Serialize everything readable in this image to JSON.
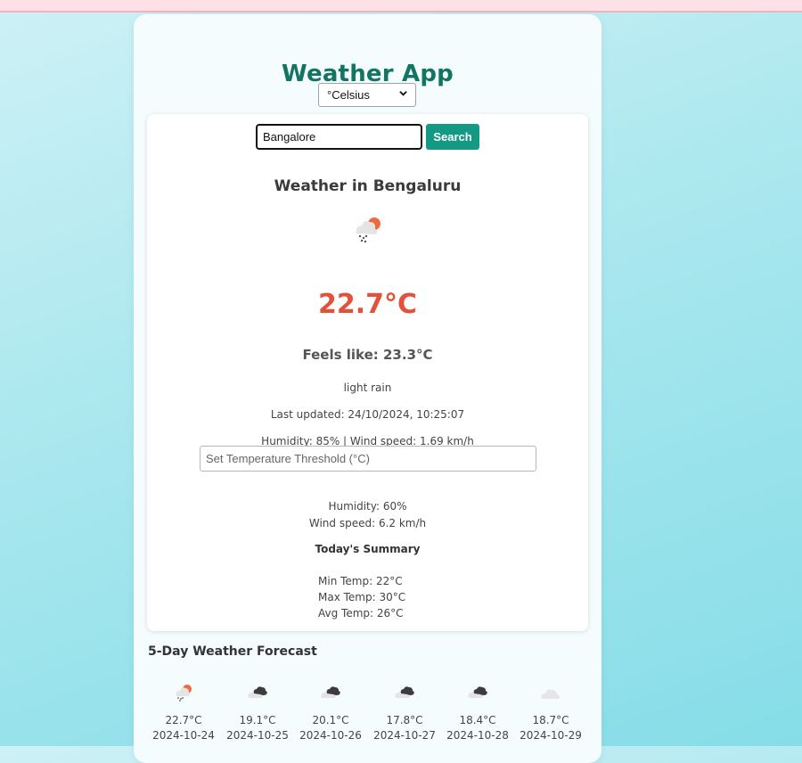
{
  "app": {
    "title": "Weather App",
    "unit_selected": "°Celsius"
  },
  "search": {
    "value": "Bangalore",
    "button_label": "Search"
  },
  "current": {
    "heading": "Weather in Bengaluru",
    "icon": "light-rain-icon",
    "temperature": "22.7°C",
    "feels_like": "Feels like: 23.3°C",
    "description": "light rain",
    "last_updated": "Last updated: 24/10/2024, 10:25:07",
    "humidity_wind": "Humidity: 85% | Wind speed: 1.69 km/h"
  },
  "threshold": {
    "placeholder": "Set Temperature Threshold (°C)"
  },
  "extra": {
    "humidity": "Humidity: 60%",
    "wind": "Wind speed: 6.2 km/h"
  },
  "summary": {
    "title": "Today's Summary",
    "min": "Min Temp: 22°C",
    "max": "Max Temp: 30°C",
    "avg": "Avg Temp: 26°C"
  },
  "forecast": {
    "title": "5-Day Weather Forecast",
    "days": [
      {
        "icon": "light-rain-icon",
        "temp": "22.7°C",
        "date": "2024-10-24"
      },
      {
        "icon": "broken-clouds-icon",
        "temp": "19.1°C",
        "date": "2024-10-25"
      },
      {
        "icon": "broken-clouds-icon",
        "temp": "20.1°C",
        "date": "2024-10-26"
      },
      {
        "icon": "broken-clouds-icon",
        "temp": "17.8°C",
        "date": "2024-10-27"
      },
      {
        "icon": "broken-clouds-icon",
        "temp": "18.4°C",
        "date": "2024-10-28"
      },
      {
        "icon": "cloud-icon",
        "temp": "18.7°C",
        "date": "2024-10-29"
      }
    ]
  },
  "colors": {
    "title": "#127463",
    "temperature": "#e3513a",
    "button": "#149a84"
  }
}
